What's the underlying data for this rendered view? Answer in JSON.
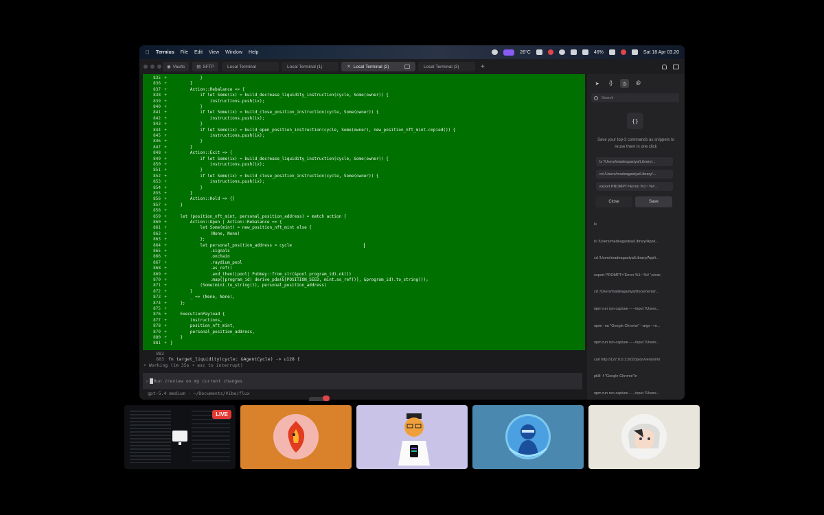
{
  "menubar": {
    "app_name": "Termius",
    "menus": [
      "File",
      "Edit",
      "View",
      "Window",
      "Help"
    ],
    "weather": "26°C",
    "battery": "46%",
    "datetime": "Sat 18 Apr  03.20"
  },
  "tabbar": {
    "vaults_label": "Vaults",
    "sftp_label": "SFTP",
    "tabs": [
      "Local Terminal",
      "Local Terminal (1)",
      "Local Terminal (2)",
      "Local Terminal (3)"
    ],
    "new_tab": "+"
  },
  "code": {
    "lines": [
      {
        "n": "835",
        "m": "+",
        "t": "            }"
      },
      {
        "n": "836",
        "m": "+",
        "t": "        }"
      },
      {
        "n": "837",
        "m": "+",
        "t": "        Action::Rebalance => {"
      },
      {
        "n": "838",
        "m": "+",
        "t": "            if let Some(ix) = build_decrease_liquidity_instruction(cycle, Some(owner)) {"
      },
      {
        "n": "839",
        "m": "+",
        "t": "                instructions.push(ix);"
      },
      {
        "n": "840",
        "m": "+",
        "t": "            }"
      },
      {
        "n": "841",
        "m": "+",
        "t": "            if let Some(ix) = build_close_position_instruction(cycle, Some(owner)) {"
      },
      {
        "n": "842",
        "m": "+",
        "t": "                instructions.push(ix);"
      },
      {
        "n": "843",
        "m": "+",
        "t": "            }"
      },
      {
        "n": "844",
        "m": "+",
        "t": "            if let Some(ix) = build_open_position_instruction(cycle, Some(owner), new_position_nft_mint.copied()) {"
      },
      {
        "n": "845",
        "m": "+",
        "t": "                instructions.push(ix);"
      },
      {
        "n": "846",
        "m": "+",
        "t": "            }"
      },
      {
        "n": "847",
        "m": "+",
        "t": "        }"
      },
      {
        "n": "848",
        "m": "+",
        "t": "        Action::Exit => {"
      },
      {
        "n": "849",
        "m": "+",
        "t": "            if let Some(ix) = build_decrease_liquidity_instruction(cycle, Some(owner)) {"
      },
      {
        "n": "850",
        "m": "+",
        "t": "                instructions.push(ix);"
      },
      {
        "n": "851",
        "m": "+",
        "t": "            }"
      },
      {
        "n": "852",
        "m": "+",
        "t": "            if let Some(ix) = build_close_position_instruction(cycle, Some(owner)) {"
      },
      {
        "n": "853",
        "m": "+",
        "t": "                instructions.push(ix);"
      },
      {
        "n": "854",
        "m": "+",
        "t": "            }"
      },
      {
        "n": "855",
        "m": "+",
        "t": "        }"
      },
      {
        "n": "856",
        "m": "+",
        "t": "        Action::Hold => {}"
      },
      {
        "n": "857",
        "m": "+",
        "t": "    }"
      },
      {
        "n": "858",
        "m": "+",
        "t": ""
      },
      {
        "n": "859",
        "m": "+",
        "t": "    let (position_nft_mint, personal_position_address) = match action {"
      },
      {
        "n": "860",
        "m": "+",
        "t": "        Action::Open | Action::Rebalance => {"
      },
      {
        "n": "861",
        "m": "+",
        "t": "            let Some(mint) = new_position_nft_mint else {"
      },
      {
        "n": "862",
        "m": "+",
        "t": "                (None, None)"
      },
      {
        "n": "863",
        "m": "+",
        "t": "            };"
      },
      {
        "n": "864",
        "m": "+",
        "t": "            let personal_position_address = cycle"
      },
      {
        "n": "865",
        "m": "+",
        "t": "                .signals"
      },
      {
        "n": "866",
        "m": "+",
        "t": "                .onchain"
      },
      {
        "n": "867",
        "m": "+",
        "t": "                .raydium_pool"
      },
      {
        "n": "868",
        "m": "+",
        "t": "                .as_ref()"
      },
      {
        "n": "869",
        "m": "+",
        "t": "                .and_then(|pool| Pubkey::from_str(&pool.program_id).ok())"
      },
      {
        "n": "870",
        "m": "+",
        "t": "                .map(|program_id| derive_pda(&[POSITION_SEED, mint.as_ref()], &program_id).to_string());"
      },
      {
        "n": "871",
        "m": "+",
        "t": "            (Some(mint.to_string()), personal_position_address)"
      },
      {
        "n": "872",
        "m": "+",
        "t": "        }"
      },
      {
        "n": "873",
        "m": "+",
        "t": "        _ => (None, None),"
      },
      {
        "n": "874",
        "m": "+",
        "t": "    };"
      },
      {
        "n": "875",
        "m": "+",
        "t": ""
      },
      {
        "n": "876",
        "m": "+",
        "t": "    ExecutionPayload {"
      },
      {
        "n": "877",
        "m": "+",
        "t": "        instructions,"
      },
      {
        "n": "878",
        "m": "+",
        "t": "        position_nft_mint,"
      },
      {
        "n": "879",
        "m": "+",
        "t": "        personal_position_address,"
      },
      {
        "n": "880",
        "m": "+",
        "t": "    }"
      },
      {
        "n": "881",
        "m": "+",
        "t": "}"
      }
    ],
    "after_lines": [
      {
        "n": "882",
        "t": ""
      },
      {
        "n": "883",
        "t": "fn target_liquidity(cycle: &AgentCycle) -> u128 {"
      }
    ]
  },
  "terminal": {
    "working": "• Working (1m 35s • esc to interrupt)",
    "prompt_text": "Run /review on my current changes",
    "prompt_marker": "›",
    "status_line": "gpt-5.4 medium · ~/Documents/Vibe/flux"
  },
  "snippets": {
    "search_placeholder": "Search",
    "empty_icon": "{}",
    "description": "Save your top-3 commands as snippets to reuse them in one click",
    "suggestions": [
      "ls '/Users/madeagastya/Library/...",
      "cd /Users/madeagastya/Library/...",
      "export PROMPT='Erron %1~ %#..."
    ],
    "close_label": "Close",
    "save_label": "Save",
    "history": [
      "ls",
      "ls '/Users/madeagastya/Library/Appli...",
      "cd /Users/madeagastya/Library/Appli...",
      "export PROMPT='Erron %1~ %# ';clear;",
      "cd '/Users/madeagastya/Documents/...",
      "npm run run-capture -- --input '/Users...",
      "open -na \"Google Chrome\" --args --re...",
      "npm run run-capture -- --input '/Users...",
      "curl http://127.0.0.1:9222/json/version\\n",
      "pkill -f \"Google Chrome\"\\n",
      "npm run run-capture -- --input '/Users..."
    ]
  },
  "tiles": {
    "live_label": "LIVE"
  },
  "colors": {
    "terminal_green": "#007000",
    "live_red": "#e53935",
    "tile_orange": "#d9822b",
    "tile_lavender": "#c9c3e8",
    "tile_blue": "#4a88b0",
    "tile_cream": "#e8e5dc"
  }
}
